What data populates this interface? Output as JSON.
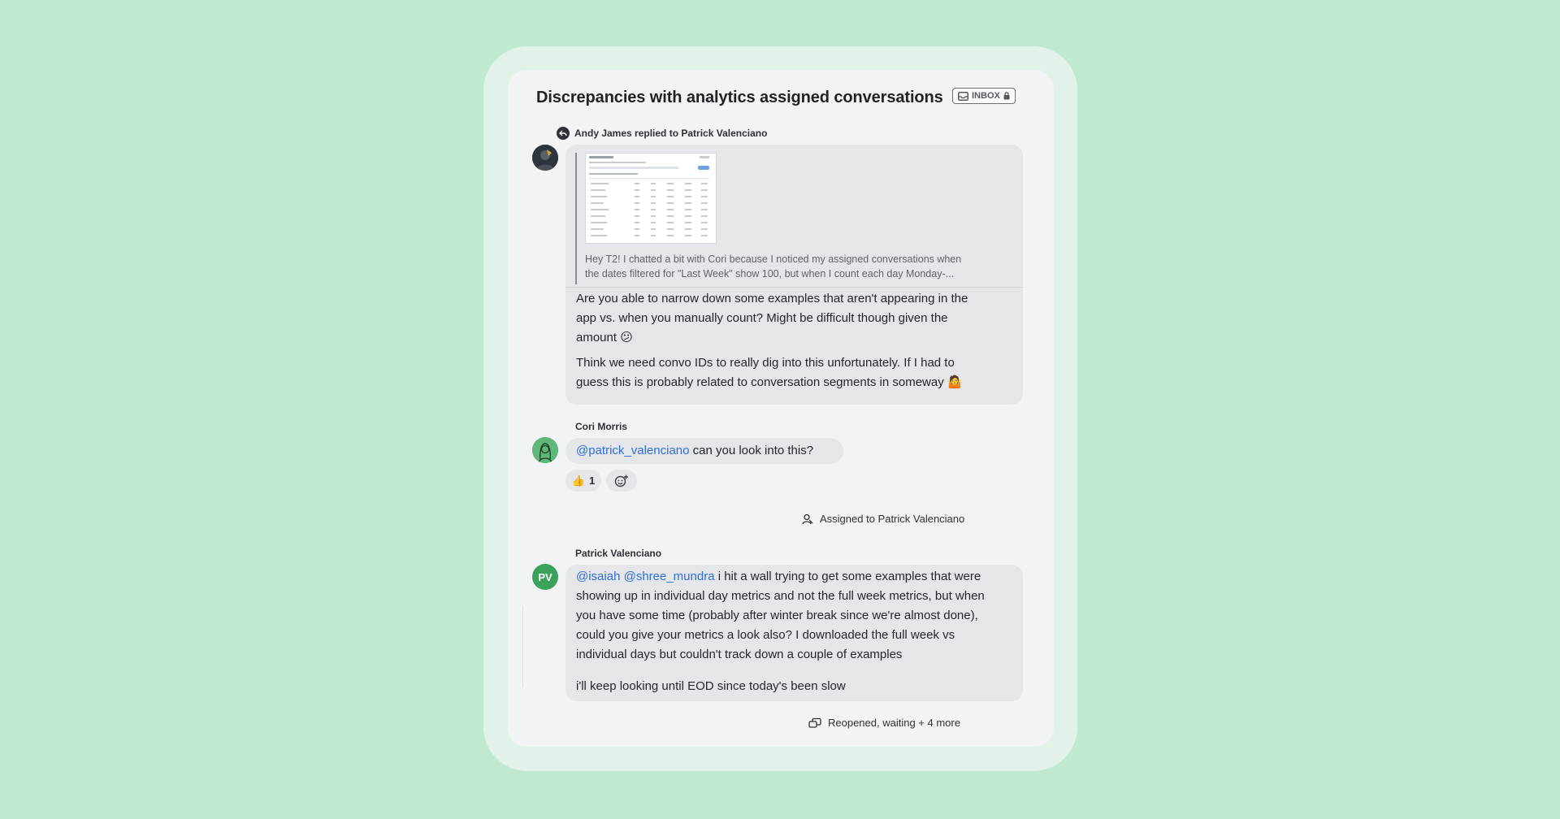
{
  "conversation": {
    "title": "Discrepancies with analytics assigned conversations",
    "badge_label": "INBOX"
  },
  "messages": {
    "andy": {
      "reply_context": "Andy James replied to Patrick Valenciano",
      "quoted_line_1": "Hey T2! I chatted a bit with Cori because I noticed my assigned conversations when",
      "quoted_line_2": "the dates filtered for \"Last Week\" show 100, but when I count each day Monday-...",
      "para1_line1": "Are you able to narrow down some examples that aren't appearing in the",
      "para1_line2": "app vs. when you manually count? Might be difficult though given the",
      "para1_line3": "amount 😕",
      "para2_line1": "Think we need convo IDs to really dig into this unfortunately. If I had to",
      "para2_line2": "guess this is probably related to conversation segments in someway 🤷"
    },
    "cori": {
      "author": "Cori Morris",
      "mention": "@patrick_valenciano",
      "text": " can you look into this?",
      "reaction_emoji": "👍",
      "reaction_count": "1"
    },
    "pv": {
      "author": "Patrick Valenciano",
      "avatar_initials": "PV",
      "mention1": "@isaiah",
      "mention2": "@shree_mundra",
      "line1_rest": " i hit a wall trying to get some examples that were",
      "line2": "showing up in individual day metrics and not the full week metrics, but when",
      "line3": "you have some time (probably after winter break since we're almost done),",
      "line4": "could you give your metrics a look also? I downloaded the full week vs",
      "line5": "individual days but couldn't track down a couple of examples",
      "line6": "i'll keep looking until EOD since today's been slow"
    }
  },
  "events": {
    "assigned": "Assigned to Patrick Valenciano",
    "reopened": "Reopened, waiting + 4 more"
  },
  "colors": {
    "background": "#c1e8d0",
    "panel": "#f2f3f5",
    "bubble": "#e5e6e9",
    "mention": "#2f6fd6"
  }
}
